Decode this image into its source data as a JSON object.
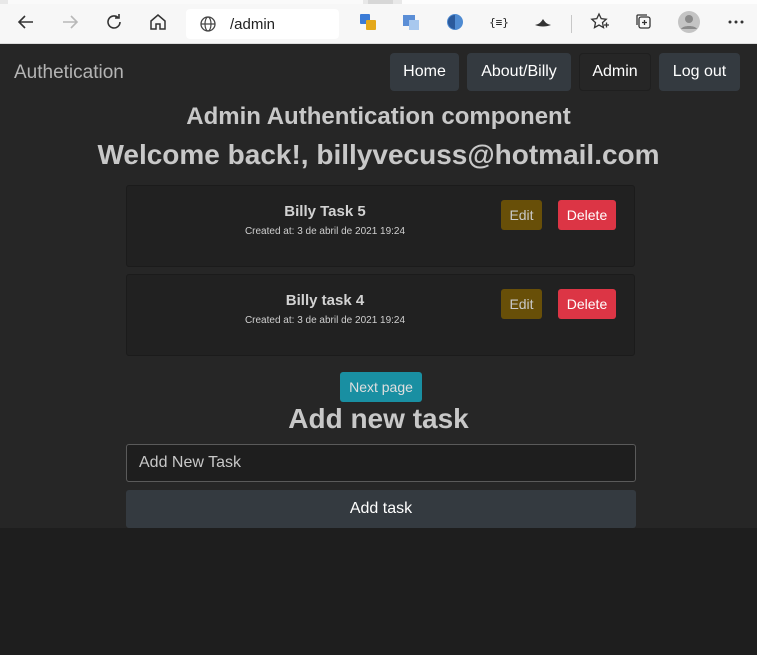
{
  "browser": {
    "url": "/admin"
  },
  "navbar": {
    "brand": "Authetication",
    "links": [
      "Home",
      "About/Billy",
      "Admin",
      "Log out"
    ]
  },
  "main": {
    "title": "Admin Authentication component",
    "welcome": "Welcome back!, billyvecuss@hotmail.com",
    "tasks": [
      {
        "title": "Billy Task 5",
        "created": "Created at: 3 de abril de 2021 19:24",
        "edit_label": "Edit",
        "delete_label": "Delete"
      },
      {
        "title": "Billy task 4",
        "created": "Created at: 3 de abril de 2021 19:24",
        "edit_label": "Edit",
        "delete_label": "Delete"
      }
    ],
    "next_page_label": "Next page",
    "add_heading": "Add new task",
    "new_task_placeholder": "Add New Task",
    "add_button_label": "Add task"
  },
  "colors": {
    "background": "#1e1e1e",
    "navbar": "#262626",
    "button_dark": "#343a40",
    "edit": "#684f08",
    "delete": "#dc3545",
    "next": "#17a2b8"
  }
}
